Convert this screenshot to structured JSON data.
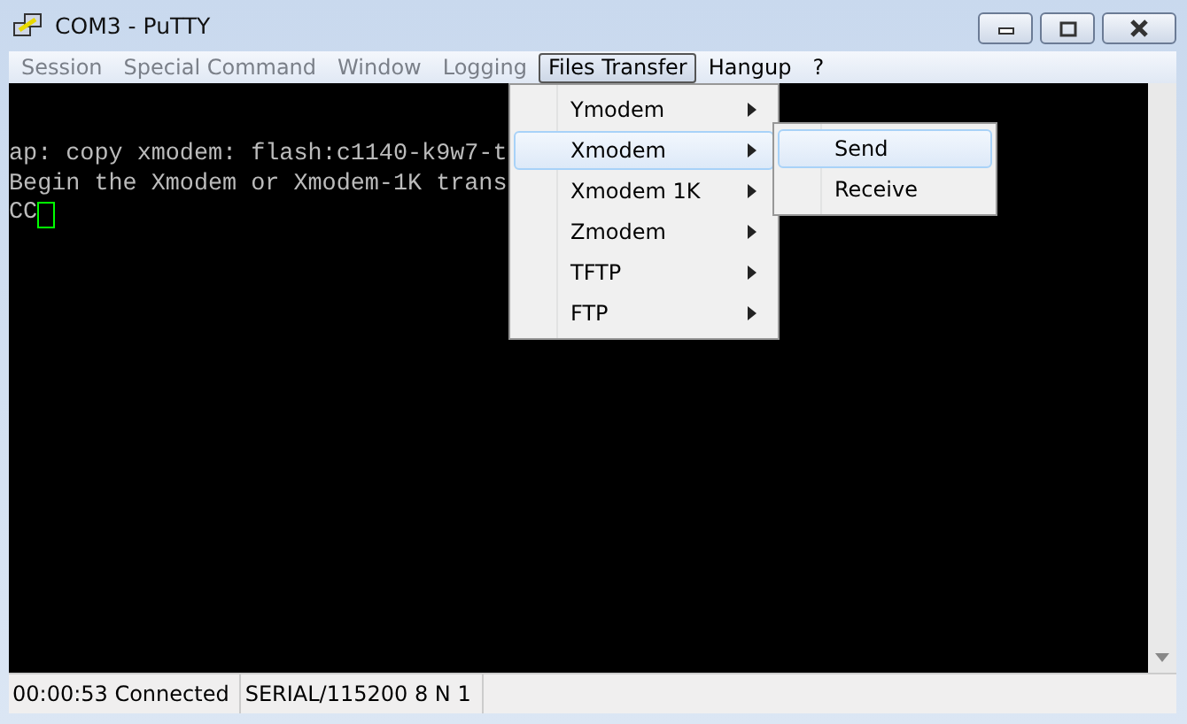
{
  "window": {
    "title": "COM3 - PuTTY"
  },
  "menu_bar": [
    {
      "label": "Session",
      "disabled": true,
      "selected": false
    },
    {
      "label": "Special Command",
      "disabled": true,
      "selected": false
    },
    {
      "label": "Window",
      "disabled": true,
      "selected": false
    },
    {
      "label": "Logging",
      "disabled": true,
      "selected": false
    },
    {
      "label": "Files Transfer",
      "disabled": false,
      "selected": true
    },
    {
      "label": "Hangup",
      "disabled": false,
      "selected": false
    },
    {
      "label": "?",
      "disabled": false,
      "selected": false
    }
  ],
  "terminal": {
    "lines": [
      "ap: copy xmodem: flash:c1140-k9w7-t",
      "Begin the Xmodem or Xmodem-1K trans",
      "CC"
    ]
  },
  "menu": [
    {
      "label": "Ymodem",
      "selected": false
    },
    {
      "label": "Xmodem",
      "selected": true
    },
    {
      "label": "Xmodem 1K",
      "selected": false
    },
    {
      "label": "Zmodem",
      "selected": false
    },
    {
      "label": "TFTP",
      "selected": false
    },
    {
      "label": "FTP",
      "selected": false
    }
  ],
  "submenu": [
    {
      "label": "Send",
      "selected": true
    },
    {
      "label": "Receive",
      "selected": false
    }
  ],
  "status_bar": [
    "00:00:53 Connected",
    "SERIAL/115200 8 N 1"
  ]
}
